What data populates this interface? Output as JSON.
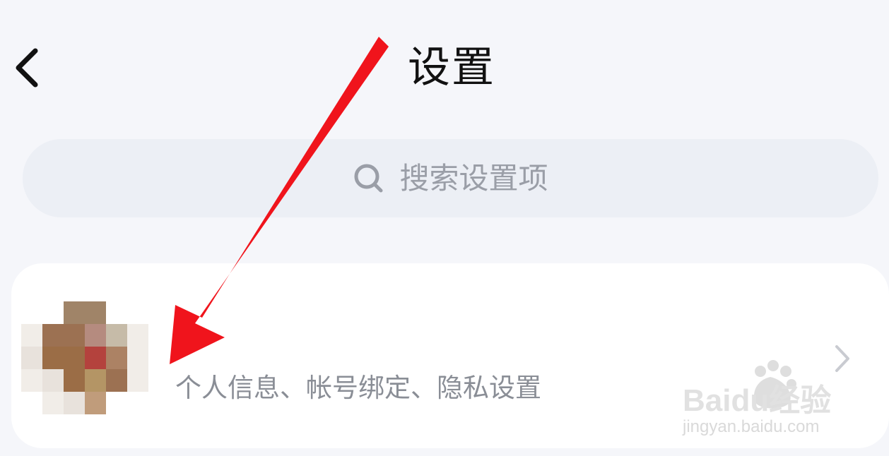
{
  "header": {
    "title": "设置"
  },
  "search": {
    "placeholder": "搜索设置项"
  },
  "account_card": {
    "subtitle": "个人信息、帐号绑定、隐私设置"
  },
  "watermark": {
    "brand": "Baidu经验",
    "url": "jingyan.baidu.com"
  },
  "colors": {
    "background": "#f5f6fa",
    "card": "#ffffff",
    "search_field": "#eceff5",
    "title_text": "#111111",
    "muted_text": "#8a8e96",
    "annotation_arrow": "#f0141c",
    "watermark_text": "#d6d6d6"
  },
  "icons": {
    "back": "back-arrow-icon",
    "search": "search-icon",
    "disclosure": "chevron-right-icon"
  },
  "avatar": {
    "style": "pixelated",
    "palette": [
      "#ffffff",
      "#a08468",
      "#9c7152",
      "#b58b7f",
      "#d8cec4",
      "#b4423d",
      "#c6bba8",
      "#9b6d46",
      "#e8e2dc",
      "#b49565",
      "#c09c7b",
      "#f1ede8",
      "#7f5f3f",
      "#ac8264"
    ]
  }
}
